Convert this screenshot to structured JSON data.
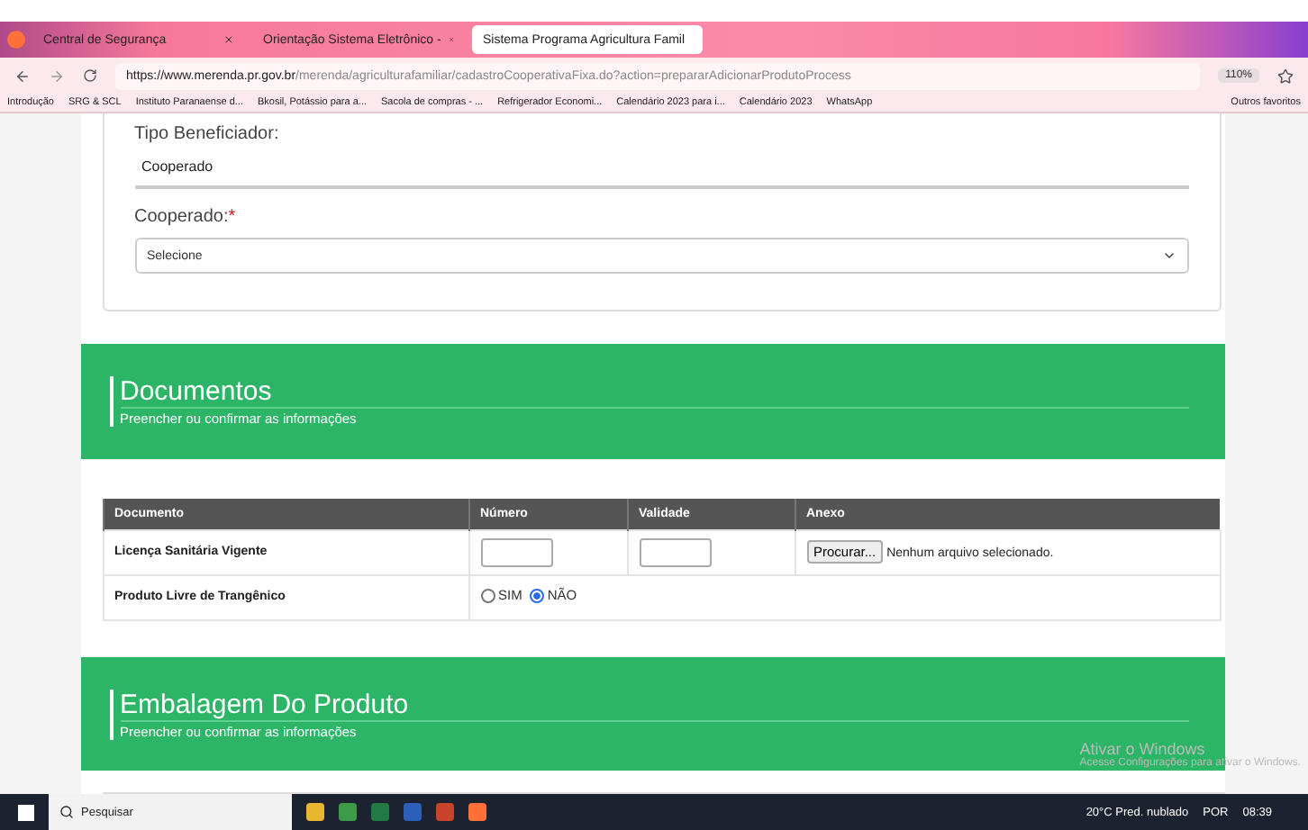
{
  "browser": {
    "tabs": [
      {
        "label": "Central de Segurança",
        "selected": false
      },
      {
        "label": "Orientação Sistema Eletrônico -",
        "selected": false
      },
      {
        "label": "Sistema Programa Agricultura Famil",
        "selected": true
      }
    ],
    "url_host": "https://www.merenda.pr.gov.br",
    "url_path": "/merenda/agriculturafamiliar/cadastroCooperativaFixa.do?action=prepararAdicionarProdutoProcess",
    "zoom": "110%",
    "bookmarks": [
      "Introdução",
      "SRG & SCL",
      "Instituto Paranaense d...",
      "Bkosil, Potássio para a...",
      "Sacola de compras - ...",
      "Refrigerador Economi...",
      "Calendário 2023 para i...",
      "Calendário 2023",
      "WhatsApp"
    ],
    "other_bookmarks": "Outros favoritos"
  },
  "form": {
    "tipo_label": "Tipo Beneficiador:",
    "tipo_value": "Cooperado",
    "cooperado_label": "Cooperado:",
    "required_mark": "*",
    "cooperado_placeholder": "Selecione"
  },
  "documentos": {
    "title": "Documentos",
    "subtitle": "Preencher ou confirmar as informações",
    "columns": [
      "Documento",
      "Número",
      "Validade",
      "Anexo"
    ],
    "rows": [
      {
        "kind": "inputs",
        "name": "Licença Sanitária Vigente",
        "browse": "Procurar...",
        "file_status": "Nenhum arquivo selecionado."
      },
      {
        "kind": "radio",
        "name": "Produto Livre de Trangênico",
        "options": [
          {
            "label": "SIM",
            "selected": false
          },
          {
            "label": "NÃO",
            "selected": true
          }
        ]
      }
    ]
  },
  "embalagem": {
    "title": "Embalagem Do Produto",
    "subtitle": "Preencher ou confirmar as informações"
  },
  "activation": {
    "title": "Ativar o Windows",
    "text": "Acesse Configurações para ativar o Windows."
  },
  "taskbar": {
    "search": "Pesquisar",
    "weather": "20°C  Pred. nublado",
    "lang": "POR",
    "time": "08:39"
  }
}
